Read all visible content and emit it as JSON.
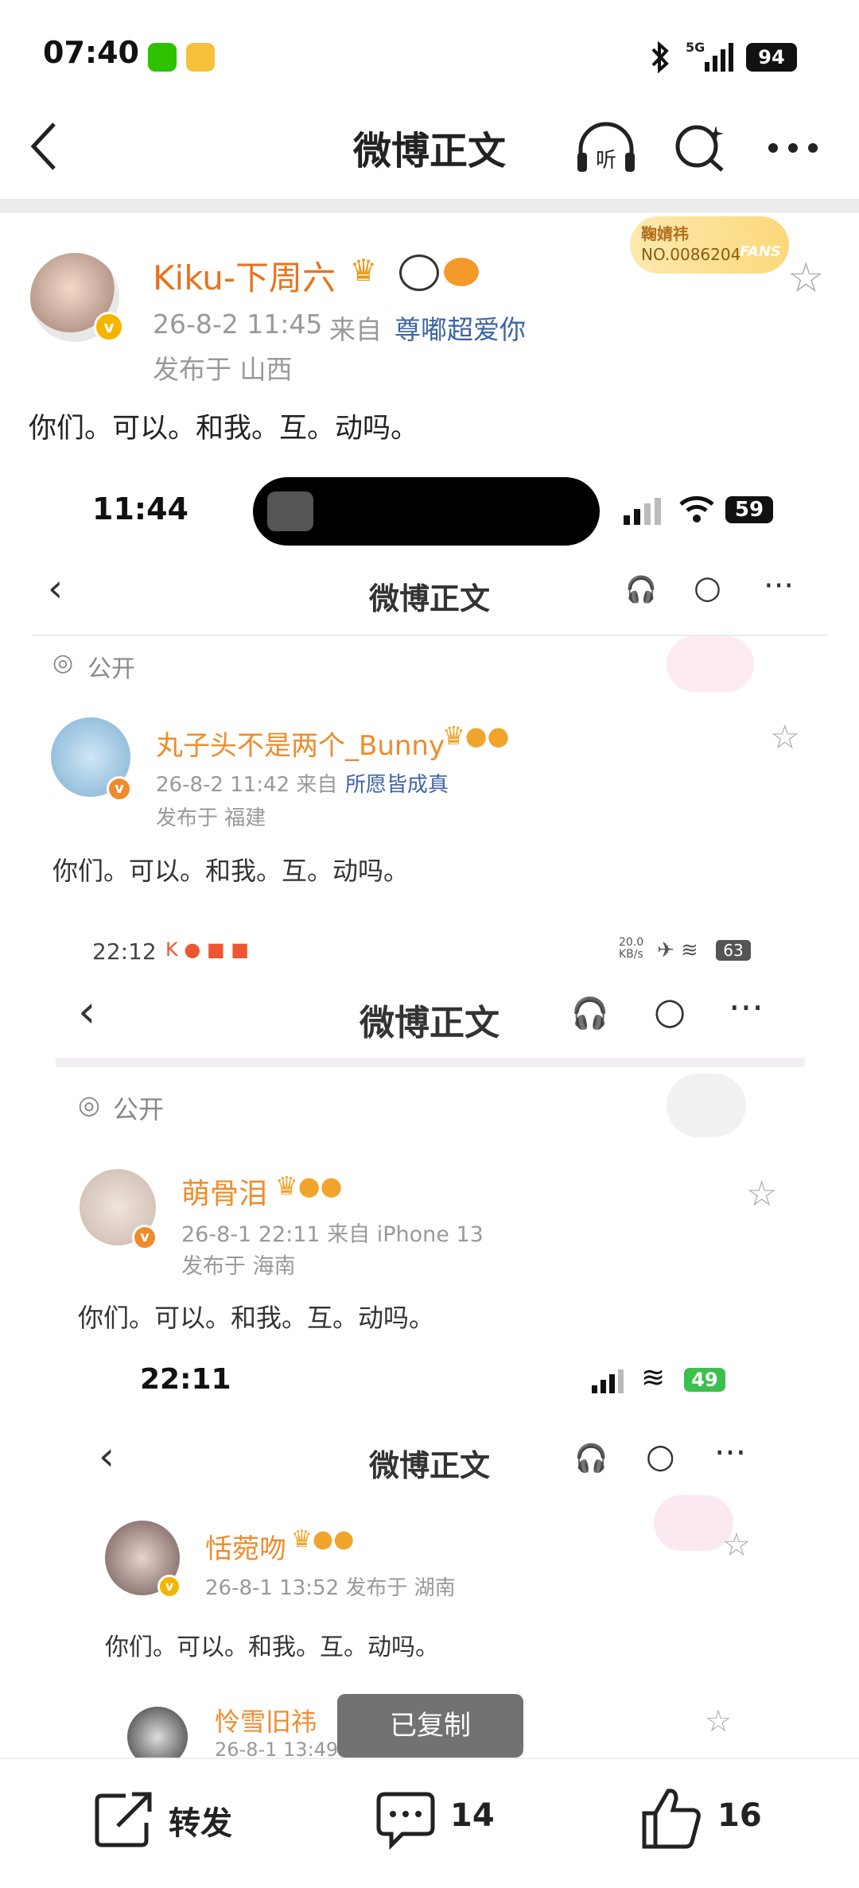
{
  "status_bar": {
    "time": "07:40",
    "battery": "94",
    "network": "5G"
  },
  "header": {
    "title": "微博正文"
  },
  "post": {
    "username": "Kiku-下周六",
    "date": "26-8-2 11:45",
    "source_prefix": "来自",
    "source": "尊嘟超爱你",
    "location": "发布于 山西",
    "text": "你们。可以。和我。互。动吗。",
    "fans_badge": {
      "name": "鞠婧祎",
      "number": "NO.0086204",
      "tag": "FANS"
    }
  },
  "shot1": {
    "time": "11:44",
    "battery": "59",
    "title": "微博正文",
    "visibility": "公开",
    "username": "丸子头不是两个_Bunny",
    "meta": "26-8-2 11:42  来自",
    "source": "所愿皆成真",
    "location": "发布于 福建",
    "text": "你们。可以。和我。互。动吗。"
  },
  "shot2": {
    "time": "22:12",
    "speed": "20.0 KB/s",
    "battery": "63",
    "title": "微博正文",
    "visibility": "公开",
    "username": "萌骨泪",
    "meta": "26-8-1 22:11  来自 iPhone 13",
    "location": "发布于 海南",
    "text": "你们。可以。和我。互。动吗。"
  },
  "shot3": {
    "time": "22:11",
    "battery": "49",
    "title": "微博正文",
    "username": "恬菀吻",
    "meta": "26-8-1 13:52  发布于 湖南",
    "text": "你们。可以。和我。互。动吗。",
    "next_username": "怜雪旧祎",
    "next_meta": "26-8-1 13:49",
    "toast": "已复制"
  },
  "bottom_bar": {
    "repost_label": "转发",
    "comment_count": "14",
    "like_count": "16"
  },
  "colors": {
    "username": "#e8731c",
    "link": "#3c64a5",
    "divider": "#ececec"
  }
}
